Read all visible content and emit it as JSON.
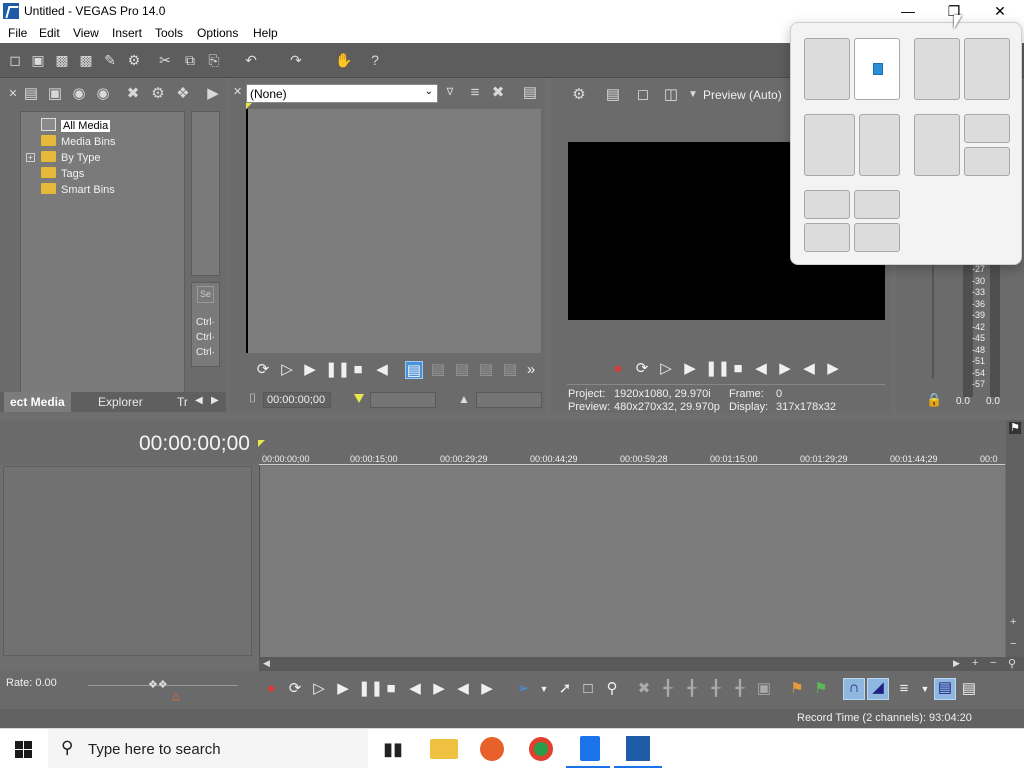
{
  "window": {
    "title": "Untitled - VEGAS Pro 14.0",
    "controls": [
      "minimize",
      "restore",
      "close"
    ]
  },
  "menu": [
    "File",
    "Edit",
    "View",
    "Insert",
    "Tools",
    "Options",
    "Help"
  ],
  "explorer": {
    "tree": [
      {
        "label": "All Media",
        "selected": true,
        "icon": "media-icon"
      },
      {
        "label": "Media Bins",
        "icon": "folder-icon"
      },
      {
        "label": "By Type",
        "icon": "folder-icon",
        "expandable": true
      },
      {
        "label": "Tags",
        "icon": "folder-icon"
      },
      {
        "label": "Smart Bins",
        "icon": "folder-icon"
      }
    ],
    "ctrl_labels": [
      "Ctrl·",
      "Ctrl·",
      "Ctrl·"
    ],
    "tabs": [
      "ect Media",
      "Explorer",
      "Tr"
    ]
  },
  "trimmer": {
    "select_value": "(None)",
    "timecode": "00:00:00;00"
  },
  "preview": {
    "mode_label": "Preview (Auto)",
    "project_label": "Project:",
    "project_value": "1920x1080, 29.970i",
    "frame_label": "Frame:",
    "frame_value": "0",
    "preview_label": "Preview:",
    "preview_value": "480x270x32, 29.970p",
    "display_label": "Display:",
    "display_value": "317x178x32"
  },
  "meters": {
    "scale": [
      "-27",
      "-30",
      "-33",
      "-36",
      "-39",
      "-42",
      "-45",
      "-48",
      "-51",
      "-54",
      "-57"
    ],
    "values": [
      "0.0",
      "0.0"
    ]
  },
  "timeline": {
    "timecode": "00:00:00;00",
    "ruler": [
      "00:00:00;00",
      "00:00:15;00",
      "00:00:29;29",
      "00:00:44;29",
      "00:00:59;28",
      "00:01:15;00",
      "00:01:29;29",
      "00:01:44;29",
      "00:0"
    ]
  },
  "bottom": {
    "rate": "Rate: 0.00",
    "record_time": "Record Time (2 channels): 93:04:20"
  },
  "taskbar": {
    "search_placeholder": "Type here to search"
  },
  "colors": {
    "panel": "#6b6b6b",
    "accent_yellow": "#e8b83a",
    "record_red": "#d83a3a",
    "highlight_blue": "#4a90d9"
  }
}
